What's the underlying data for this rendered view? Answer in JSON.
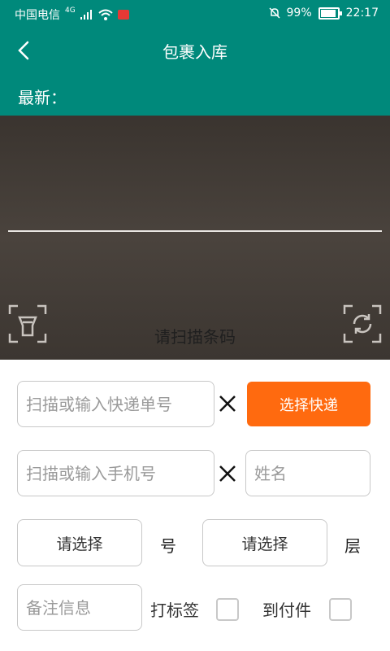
{
  "status_bar": {
    "carrier": "中国电信",
    "network": "4G",
    "battery": "99%",
    "battery_level": 0.99,
    "time": "22:17"
  },
  "header": {
    "title": "包裹入库"
  },
  "latest": {
    "label": "最新："
  },
  "scanner": {
    "hint": "请扫描条码"
  },
  "form": {
    "tracking_placeholder": "扫描或输入快递单号",
    "courier_button": "选择快递",
    "phone_placeholder": "扫描或输入手机号",
    "name_placeholder": "姓名",
    "select_number": "请选择",
    "number_unit": "号",
    "select_floor": "请选择",
    "floor_unit": "层",
    "remark_placeholder": "备注信息",
    "label_checkbox": "打标签",
    "cod_checkbox": "到付件"
  },
  "colors": {
    "primary": "#00897b",
    "accent": "#ff6a0f"
  }
}
